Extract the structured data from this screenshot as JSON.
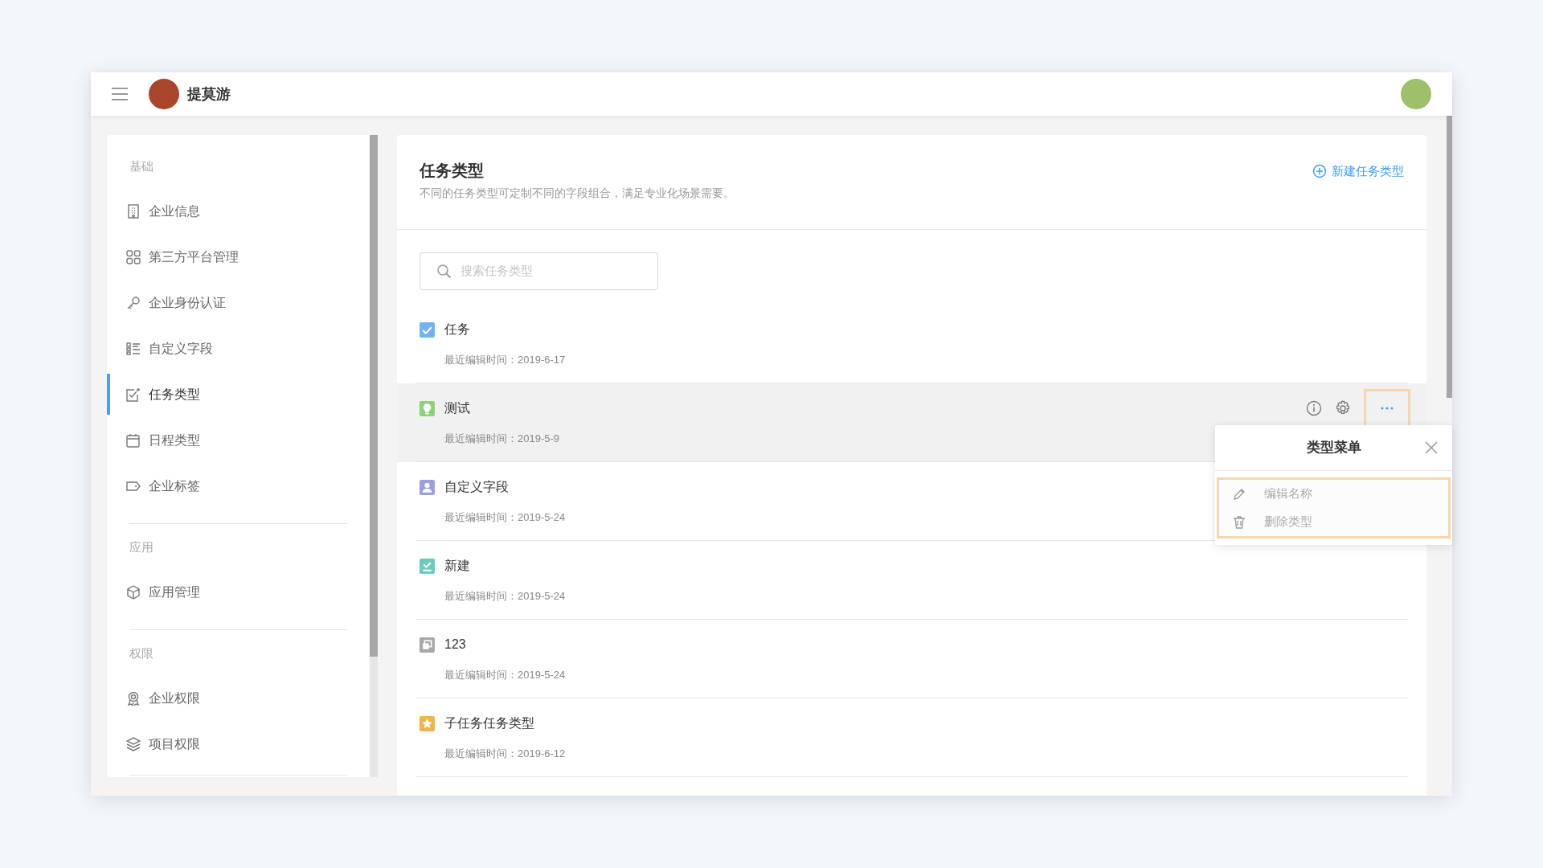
{
  "header": {
    "app_name": "提莫游"
  },
  "sidebar": {
    "sections": [
      {
        "title": "基础",
        "items": [
          {
            "label": "企业信息",
            "selected": false
          },
          {
            "label": "第三方平台管理",
            "selected": false
          },
          {
            "label": "企业身份认证",
            "selected": false
          },
          {
            "label": "自定义字段",
            "selected": false
          },
          {
            "label": "任务类型",
            "selected": true
          },
          {
            "label": "日程类型",
            "selected": false
          },
          {
            "label": "企业标签",
            "selected": false
          }
        ]
      },
      {
        "title": "应用",
        "items": [
          {
            "label": "应用管理",
            "selected": false
          }
        ]
      },
      {
        "title": "权限",
        "items": [
          {
            "label": "企业权限",
            "selected": false
          },
          {
            "label": "项目权限",
            "selected": false
          }
        ]
      }
    ]
  },
  "page": {
    "title": "任务类型",
    "description": "不同的任务类型可定制不同的字段组合，满足专业化场景需要。",
    "new_button": "新建任务类型",
    "search": {
      "placeholder": "搜索任务类型"
    }
  },
  "task_types": [
    {
      "name": "任务",
      "edited": "最近编辑时间：2019-6-17",
      "color": "#6fb3f2",
      "selected": false
    },
    {
      "name": "测试",
      "edited": "最近编辑时间：2019-5-9",
      "color": "#8fd17a",
      "selected": true
    },
    {
      "name": "自定义字段",
      "edited": "最近编辑时间：2019-5-24",
      "color": "#9b9fdc",
      "selected": false
    },
    {
      "name": "新建",
      "edited": "最近编辑时间：2019-5-24",
      "color": "#6ccbbf",
      "selected": false
    },
    {
      "name": "123",
      "edited": "最近编辑时间：2019-5-24",
      "color": "#a8a8a8",
      "selected": false
    },
    {
      "name": "子任务任务类型",
      "edited": "最近编辑时间：2019-6-12",
      "color": "#f0b44c",
      "selected": false
    }
  ],
  "type_menu": {
    "title": "类型菜单",
    "items": [
      {
        "label": "编辑名称"
      },
      {
        "label": "删除类型"
      }
    ]
  }
}
